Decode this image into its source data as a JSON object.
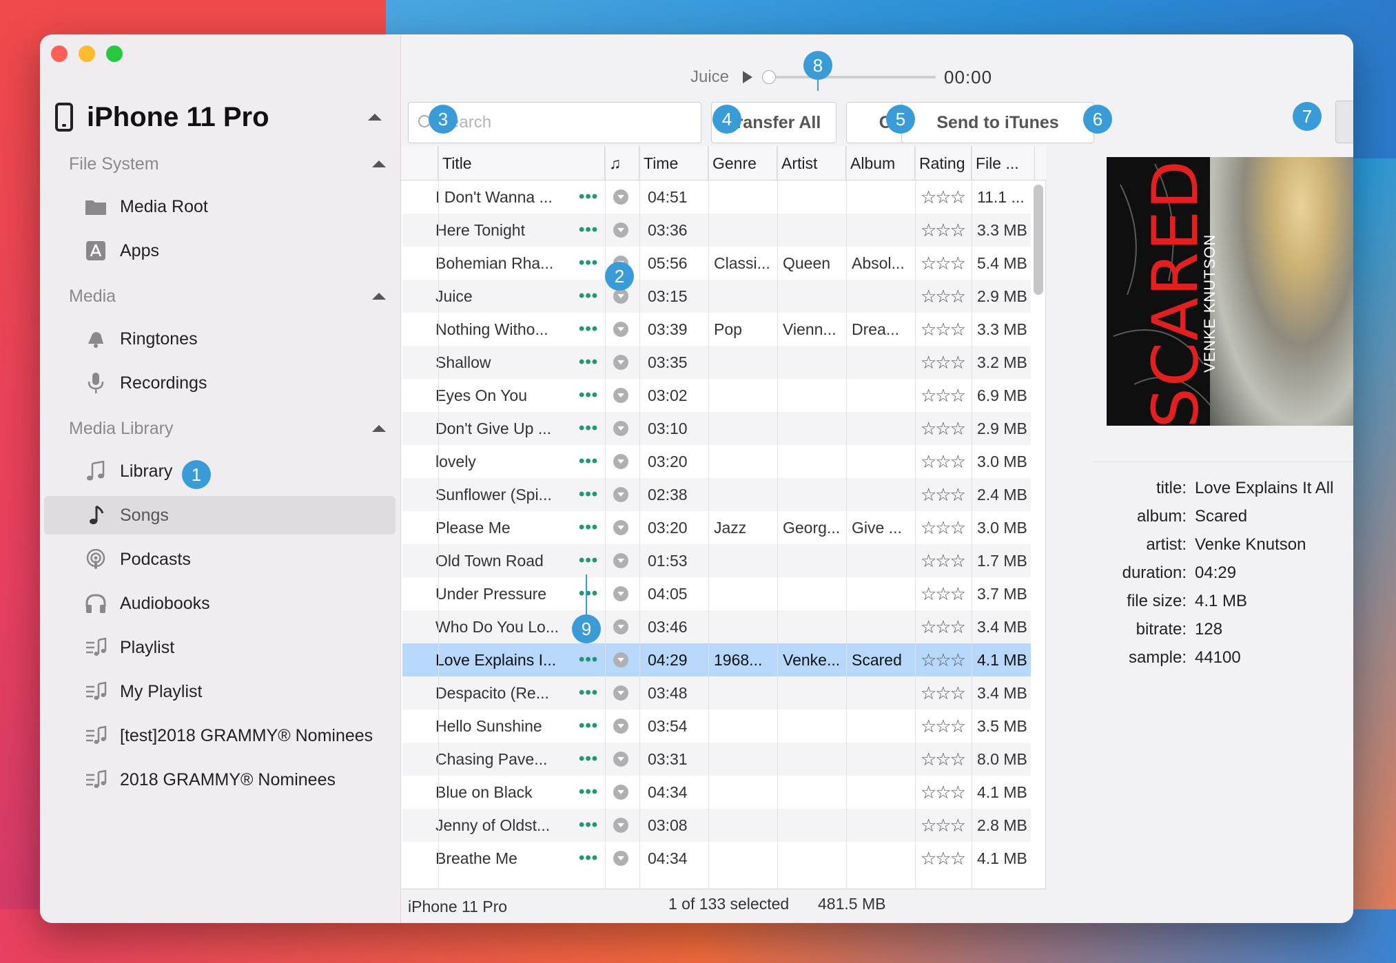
{
  "sidebar": {
    "device": "iPhone 11 Pro",
    "sections": [
      {
        "label": "File System",
        "items": [
          {
            "label": "Media Root",
            "icon": "folder-icon"
          },
          {
            "label": "Apps",
            "icon": "apps-icon"
          }
        ]
      },
      {
        "label": "Media",
        "items": [
          {
            "label": "Ringtones",
            "icon": "bell-icon"
          },
          {
            "label": "Recordings",
            "icon": "microphone-icon"
          }
        ]
      },
      {
        "label": "Media Library",
        "items": [
          {
            "label": "Library",
            "icon": "music-note-icon"
          },
          {
            "label": "Songs",
            "icon": "music-note-icon"
          },
          {
            "label": "Podcasts",
            "icon": "podcast-icon"
          },
          {
            "label": "Audiobooks",
            "icon": "headphones-icon"
          },
          {
            "label": "Playlist",
            "icon": "playlist-icon"
          },
          {
            "label": "My Playlist",
            "icon": "playlist-icon"
          },
          {
            "label": "[test]2018 GRAMMY® Nominees",
            "icon": "playlist-icon"
          },
          {
            "label": "2018 GRAMMY® Nominees",
            "icon": "playlist-icon"
          }
        ]
      }
    ],
    "selected": "Songs"
  },
  "player": {
    "title": "Juice",
    "time": "00:00",
    "progress": 0
  },
  "toolbar": {
    "search_placeholder": "Search",
    "transfer_all": "Transfer All",
    "copy_to_folder": "Copy to Folder",
    "send_to_itunes": "Send to iTunes"
  },
  "table": {
    "columns": [
      "Title",
      "♫",
      "Time",
      "Genre",
      "Artist",
      "Album",
      "Rating",
      "File ..."
    ],
    "rows": [
      {
        "title": "I Don't Wanna ...",
        "time": "04:51",
        "genre": "",
        "artist": "",
        "album": "",
        "size": "11.1 ..."
      },
      {
        "title": "Here Tonight",
        "time": "03:36",
        "genre": "",
        "artist": "",
        "album": "",
        "size": "3.3 MB"
      },
      {
        "title": "Bohemian Rha...",
        "time": "05:56",
        "genre": "Classi...",
        "artist": "Queen",
        "album": "Absol...",
        "size": "5.4 MB"
      },
      {
        "title": "Juice",
        "time": "03:15",
        "genre": "",
        "artist": "",
        "album": "",
        "size": "2.9 MB"
      },
      {
        "title": "Nothing Witho...",
        "time": "03:39",
        "genre": "Pop",
        "artist": "Vienn...",
        "album": "Drea...",
        "size": "3.3 MB"
      },
      {
        "title": "Shallow",
        "time": "03:35",
        "genre": "",
        "artist": "",
        "album": "",
        "size": "3.2 MB"
      },
      {
        "title": "Eyes On You",
        "time": "03:02",
        "genre": "",
        "artist": "",
        "album": "",
        "size": "6.9 MB"
      },
      {
        "title": "Don't Give Up ...",
        "time": "03:10",
        "genre": "",
        "artist": "",
        "album": "",
        "size": "2.9 MB"
      },
      {
        "title": "lovely",
        "time": "03:20",
        "genre": "",
        "artist": "",
        "album": "",
        "size": "3.0 MB"
      },
      {
        "title": "Sunflower (Spi...",
        "time": "02:38",
        "genre": "",
        "artist": "",
        "album": "",
        "size": "2.4 MB"
      },
      {
        "title": "Please Me",
        "time": "03:20",
        "genre": "Jazz",
        "artist": "Georg...",
        "album": "Give ...",
        "size": "3.0 MB"
      },
      {
        "title": "Old Town Road",
        "time": "01:53",
        "genre": "",
        "artist": "",
        "album": "",
        "size": "1.7 MB"
      },
      {
        "title": "Under Pressure",
        "time": "04:05",
        "genre": "",
        "artist": "",
        "album": "",
        "size": "3.7 MB"
      },
      {
        "title": "Who Do You Lo...",
        "time": "03:46",
        "genre": "",
        "artist": "",
        "album": "",
        "size": "3.4 MB"
      },
      {
        "title": "Love Explains I...",
        "time": "04:29",
        "genre": "1968...",
        "artist": "Venke...",
        "album": "Scared",
        "size": "4.1 MB",
        "selected": true
      },
      {
        "title": "Despacito (Re...",
        "time": "03:48",
        "genre": "",
        "artist": "",
        "album": "",
        "size": "3.4 MB"
      },
      {
        "title": "Hello Sunshine",
        "time": "03:54",
        "genre": "",
        "artist": "",
        "album": "",
        "size": "3.5 MB"
      },
      {
        "title": "Chasing Pave...",
        "time": "03:31",
        "genre": "",
        "artist": "",
        "album": "",
        "size": "8.0 MB"
      },
      {
        "title": "Blue on Black",
        "time": "04:34",
        "genre": "",
        "artist": "",
        "album": "",
        "size": "4.1 MB"
      },
      {
        "title": "Jenny of Oldst...",
        "time": "03:08",
        "genre": "",
        "artist": "",
        "album": "",
        "size": "2.8 MB"
      },
      {
        "title": "Breathe Me",
        "time": "04:34",
        "genre": "",
        "artist": "",
        "album": "",
        "size": "4.1 MB"
      }
    ],
    "more_glyph": "•••",
    "stars": "☆☆☆"
  },
  "status": {
    "device": "iPhone 11 Pro",
    "selection": "1 of 133 selected",
    "size": "481.5 MB"
  },
  "artwork": {
    "title_text": "SCARED",
    "artist_text": "VENKE KNUTSON"
  },
  "details": [
    {
      "key": "title:",
      "value": "Love Explains It All"
    },
    {
      "key": "album:",
      "value": "Scared"
    },
    {
      "key": "artist:",
      "value": "Venke Knutson"
    },
    {
      "key": "duration:",
      "value": "04:29"
    },
    {
      "key": "file size:",
      "value": "4.1 MB"
    },
    {
      "key": "bitrate:",
      "value": "128"
    },
    {
      "key": "sample:",
      "value": "44100"
    }
  ],
  "callouts": [
    "1",
    "2",
    "3",
    "4",
    "5",
    "6",
    "7",
    "8",
    "9"
  ],
  "colors": {
    "accent": "#3a9bd9",
    "selection": "#b8d8fb",
    "more_dots": "#1a9a74"
  }
}
